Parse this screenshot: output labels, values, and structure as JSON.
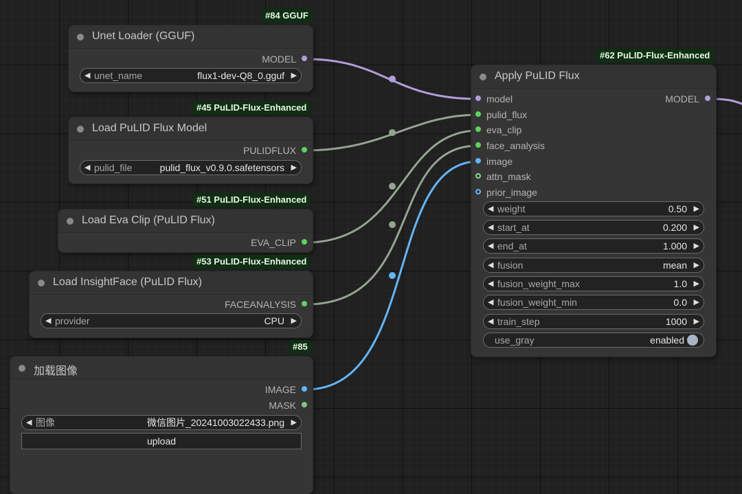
{
  "nodes": {
    "unet": {
      "badge": "#84 GGUF",
      "title": "Unet Loader (GGUF)",
      "output": "MODEL",
      "widget_label": "unet_name",
      "widget_value": "flux1-dev-Q8_0.gguf"
    },
    "pulid_model": {
      "badge": "#45 PuLID-Flux-Enhanced",
      "title": "Load PuLID Flux Model",
      "output": "PULIDFLUX",
      "widget_label": "pulid_file",
      "widget_value": "pulid_flux_v0.9.0.safetensors"
    },
    "eva_clip": {
      "badge": "#51 PuLID-Flux-Enhanced",
      "title": "Load Eva Clip (PuLID Flux)",
      "output": "EVA_CLIP"
    },
    "insightface": {
      "badge": "#53 PuLID-Flux-Enhanced",
      "title": "Load InsightFace (PuLID Flux)",
      "output": "FACEANALYSIS",
      "widget_label": "provider",
      "widget_value": "CPU"
    },
    "load_image": {
      "badge": "#85",
      "title": "加载图像",
      "outputs": [
        "IMAGE",
        "MASK"
      ],
      "widget_label": "图像",
      "widget_value": "微信图片_20241003022433.png",
      "upload_label": "upload"
    },
    "apply": {
      "badge": "#62 PuLID-Flux-Enhanced",
      "title": "Apply PuLID Flux",
      "output": "MODEL",
      "inputs": [
        "model",
        "pulid_flux",
        "eva_clip",
        "face_analysis",
        "image",
        "attn_mask",
        "prior_image"
      ],
      "widgets": [
        {
          "label": "weight",
          "value": "0.50"
        },
        {
          "label": "start_at",
          "value": "0.200"
        },
        {
          "label": "end_at",
          "value": "1.000"
        },
        {
          "label": "fusion",
          "value": "mean"
        },
        {
          "label": "fusion_weight_max",
          "value": "1.0"
        },
        {
          "label": "fusion_weight_min",
          "value": "0.0"
        },
        {
          "label": "train_step",
          "value": "1000"
        }
      ],
      "toggle": {
        "label": "use_gray",
        "value": "enabled"
      }
    }
  },
  "colors": {
    "model_link": "#b39ddb",
    "generic_link": "#93a590",
    "image_link": "#64b5f6"
  },
  "glyphs": {
    "left_arrow": "◀",
    "right_arrow": "▶"
  }
}
